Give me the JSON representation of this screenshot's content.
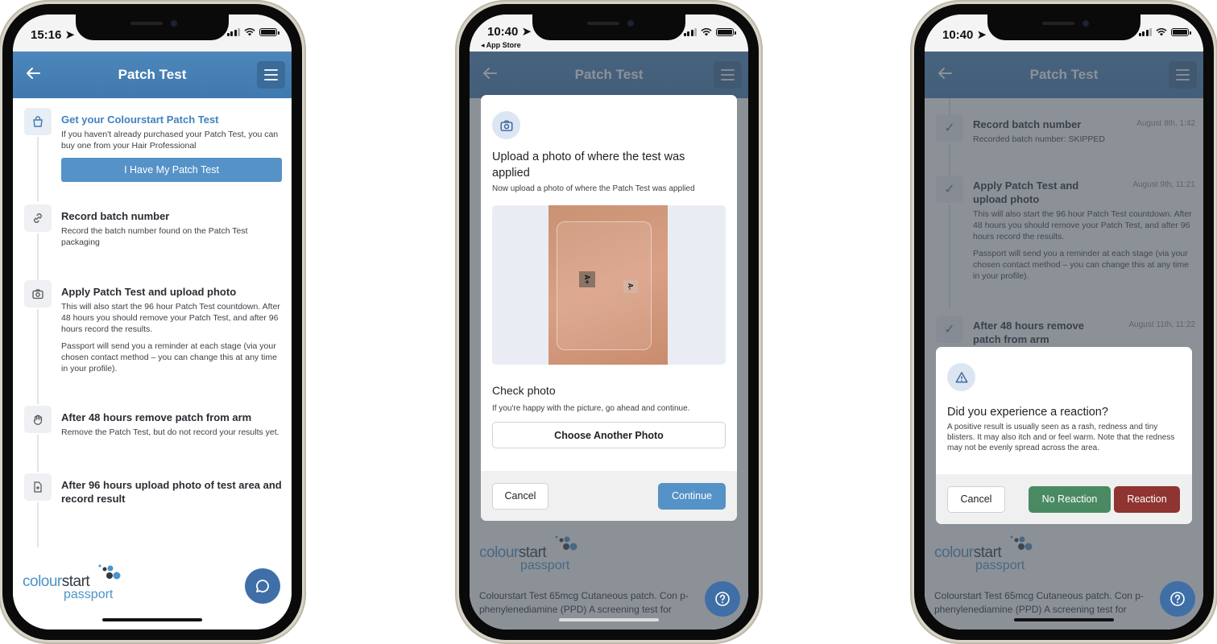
{
  "phones": [
    {
      "status": {
        "time": "15:16"
      },
      "header": {
        "title": "Patch Test"
      },
      "steps": [
        {
          "icon": "shopping-bag-icon",
          "title": "Get your Colourstart Patch Test",
          "text": [
            "If you haven't already purchased your Patch Test, you can buy one from your Hair Professional"
          ],
          "button": "I Have My Patch Test",
          "active": true
        },
        {
          "icon": "link-icon",
          "title": "Record batch number",
          "text": [
            "Record the batch number found on the Patch Test packaging"
          ]
        },
        {
          "icon": "camera-icon",
          "title": "Apply Patch Test and upload photo",
          "text": [
            "This will also start the 96 hour Patch Test countdown. After 48 hours you should remove your Patch Test, and after 96 hours record the results.",
            "Passport will send you a reminder at each stage (via your chosen contact method – you can change this at any time in your profile)."
          ]
        },
        {
          "icon": "hand-icon",
          "title": "After 48 hours remove patch from arm",
          "text": [
            "Remove the Patch Test, but do not record your results yet."
          ]
        },
        {
          "icon": "file-plus-icon",
          "title": "After 96 hours upload photo of test area and record result",
          "text": []
        }
      ],
      "logo": {
        "word1a": "colour",
        "word1b": "start",
        "word2": "passport"
      },
      "fab_icon": "chat-icon"
    },
    {
      "status": {
        "time": "10:40",
        "back_app": "◂ App Store"
      },
      "header": {
        "title": "Patch Test"
      },
      "modal": {
        "icon": "camera-icon",
        "title": "Upload a photo of where the test was applied",
        "subtitle": "Now upload a photo of where the Patch Test was applied",
        "photo_labels": [
          "A+",
          "A-"
        ],
        "check_title": "Check photo",
        "check_text": "If you're happy with the picture, go ahead and continue.",
        "choose_another": "Choose Another Photo",
        "cancel": "Cancel",
        "continue": "Continue"
      },
      "logo": {
        "word1a": "colour",
        "word1b": "start",
        "word2": "passport"
      },
      "background_text": "Colourstart Test 65mcg Cutaneous patch. Con p-phenylenediamine (PPD) A screening test for",
      "fab_icon": "help-icon"
    },
    {
      "status": {
        "time": "10:40"
      },
      "header": {
        "title": "Patch Test"
      },
      "timeline": [
        {
          "title": "Record batch number",
          "date": "August 8th, 1:42",
          "text": [
            "Recorded batch number: SKIPPED"
          ]
        },
        {
          "title": "Apply Patch Test and upload photo",
          "date": "August 9th, 11:21",
          "text": [
            "This will also start the 96 hour Patch Test countdown. After 48 hours you should remove your Patch Test, and after 96 hours record the results.",
            "Passport will send you a reminder at each stage (via your chosen contact method – you can change this at any time in your profile)."
          ]
        },
        {
          "title": "After 48 hours remove patch from arm",
          "date": "August 11th, 11:22",
          "text": []
        }
      ],
      "modal": {
        "icon": "warning-icon",
        "title": "Did you experience a reaction?",
        "text": "A positive result is usually seen as a rash, redness and tiny blisters. It may also itch and or feel warm. Note that the redness may not be evenly spread across the area.",
        "cancel": "Cancel",
        "no_reaction": "No Reaction",
        "reaction": "Reaction"
      },
      "logo": {
        "word1a": "colour",
        "word1b": "start",
        "word2": "passport"
      },
      "background_text": "Colourstart Test 65mcg Cutaneous patch. Con p-phenylenediamine (PPD) A screening test for",
      "fab_icon": "help-icon"
    }
  ],
  "colors": {
    "primary": "#4d86bb",
    "button_blue": "#5592c7",
    "green": "#4a8a63",
    "red": "#8f3431"
  }
}
